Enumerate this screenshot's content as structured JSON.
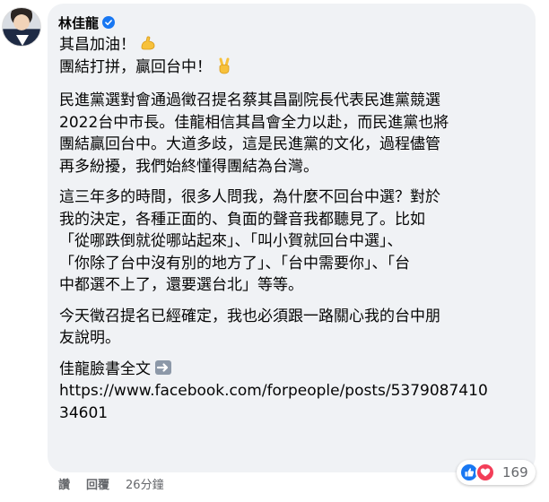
{
  "author": {
    "name": "林佳龍",
    "verified": true
  },
  "comment": {
    "lines_intro": [
      "其昌加油！",
      "團結打拼，贏回台中！"
    ],
    "para1": [
      "民進黨選對會通過徵召提名蔡其昌副院長代表民進黨競選",
      "2022台中市長。佳龍相信其昌會全力以赴，而民進黨也將",
      "團結贏回台中。大道多歧，這是民進黨的文化，過程儘管",
      "再多紛擾，我們始終懂得團結為台灣。"
    ],
    "para2": [
      "這三年多的時間，很多人問我，為什麼不回台中選？對於",
      "我的決定，各種正面的、負面的聲音我都聽見了。比如",
      "「從哪跌倒就從哪站起來」、「叫小賀就回台中選」、",
      "「你除了台中沒有別的地方了」、「台中需要你」、「台",
      "中都選不上了，還要選台北」等等。"
    ],
    "para3": [
      "今天徵召提名已經確定，我也必須跟一路關心我的台中朋",
      "友說明。"
    ],
    "link_label": "佳龍臉書全文",
    "link_url_lines": [
      "https://www.facebook.com/forpeople/posts/5379087410",
      "34601"
    ]
  },
  "actions": {
    "like": "讚",
    "reply": "回覆",
    "time": "26分鐘"
  },
  "reactions": {
    "count": "169",
    "types": [
      "like-icon",
      "love-icon"
    ]
  },
  "colors": {
    "bubble": "#f0f2f5",
    "verified": "#1877f2",
    "like": "#1877f2",
    "love": "#f33e58",
    "meta_text": "#65676b"
  }
}
